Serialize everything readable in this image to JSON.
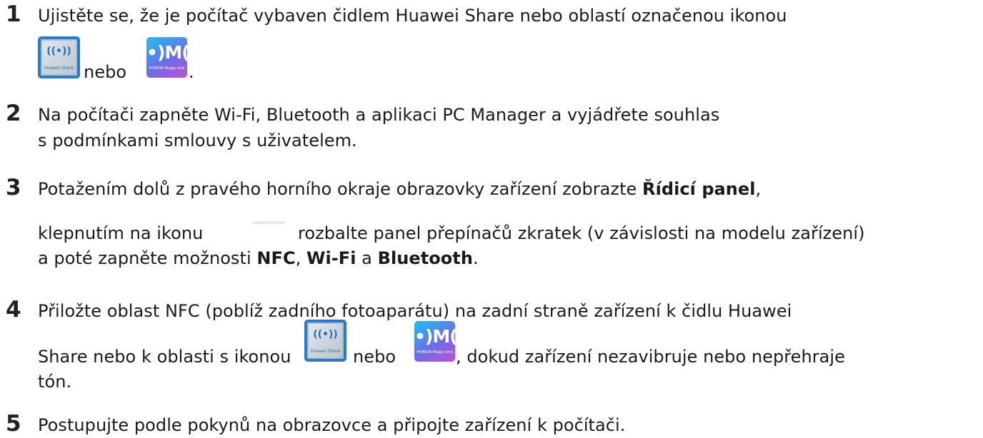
{
  "steps": [
    {
      "number": "1",
      "line1": "Ujistěte se, že je počítač vybaven čidlem Huawei Share nebo oblastí označenou ikonou",
      "line2_mid": "nebo",
      "line2_end": "."
    },
    {
      "number": "2",
      "line1": "Na počítači zapněte Wi-Fi, Bluetooth a aplikaci PC Manager a vyjádřete souhlas",
      "line2": "s podmínkami smlouvy s uživatelem."
    },
    {
      "number": "3",
      "line1_a": "Potažením dolů z pravého horního okraje obrazovky zařízení zobrazte ",
      "line1_b": "Řídicí panel",
      "line1_c": ",",
      "line2_a": "klepnutím na ikonu",
      "line2_b": "rozbalte panel přepínačů zkratek (v závislosti na modelu zařízení)",
      "line3_a": "a poté zapněte možnosti ",
      "line3_b": "NFC",
      "line3_c": ", ",
      "line3_d": "Wi-Fi",
      "line3_e": " a ",
      "line3_f": "Bluetooth",
      "line3_g": "."
    },
    {
      "number": "4",
      "line1": "Přiložte oblast NFC (poblíž zadního fotoaparátu) na zadní straně zařízení k čidlu Huawei",
      "line2_a": "Share nebo k oblasti s ikonou",
      "line2_b": "nebo",
      "line2_c": ", dokud zařízení nezavibruje nebo nepřehraje",
      "line3": "tón."
    },
    {
      "number": "5",
      "line1": "Postupujte podle pokynů na obrazovce a připojte zařízení k počítači."
    }
  ],
  "icons": {
    "huawei_share": {
      "waves": "((•))",
      "caption": "Huawei Share",
      "color": "#2f78c4"
    },
    "honor_magic_link": {
      "mark": "•)M(•",
      "caption": "HONOR Magic-link",
      "gradient": [
        "#1ec0f0",
        "#6a6de8",
        "#c24fd0"
      ]
    }
  }
}
